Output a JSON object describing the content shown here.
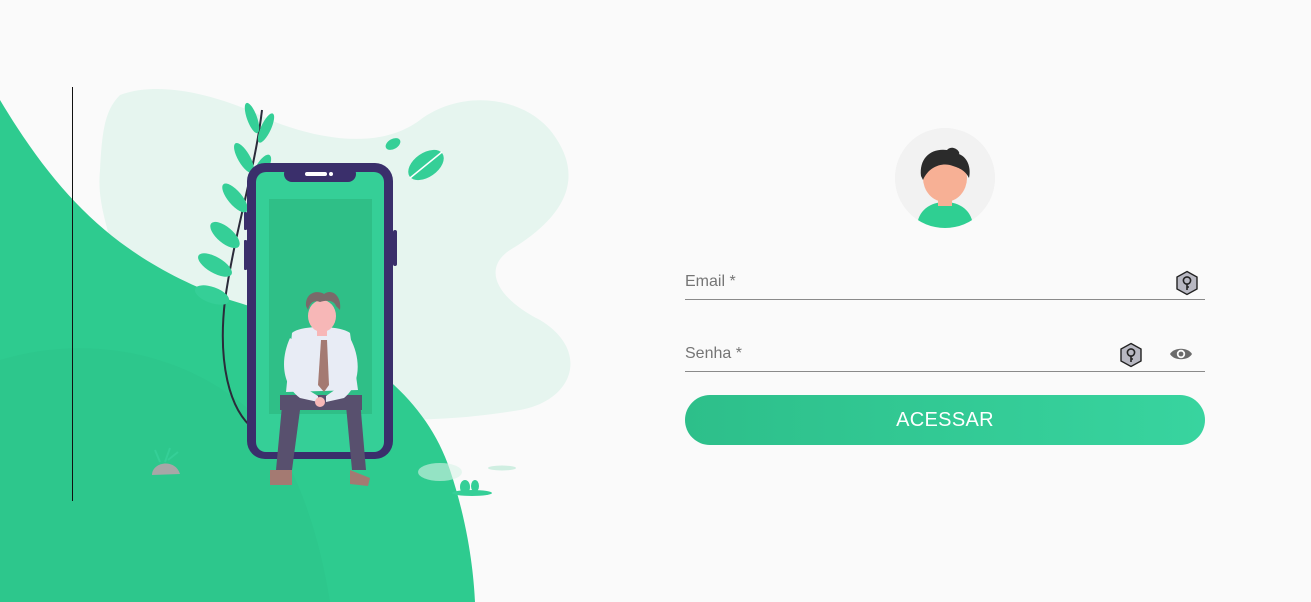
{
  "colors": {
    "brand": "#2fcf92",
    "brand_dark": "#2dbf8a",
    "phone_frame": "#3a2f6b",
    "blob_bg": "#e6f5ef"
  },
  "login": {
    "email_label": "Email *",
    "email_value": "",
    "password_label": "Senha *",
    "password_value": "",
    "submit_label": "ACESSAR"
  },
  "icons": {
    "avatar": "user-avatar-icon",
    "email_suffix": "key-icon",
    "password_suffix": "key-icon",
    "password_toggle": "eye-icon"
  }
}
